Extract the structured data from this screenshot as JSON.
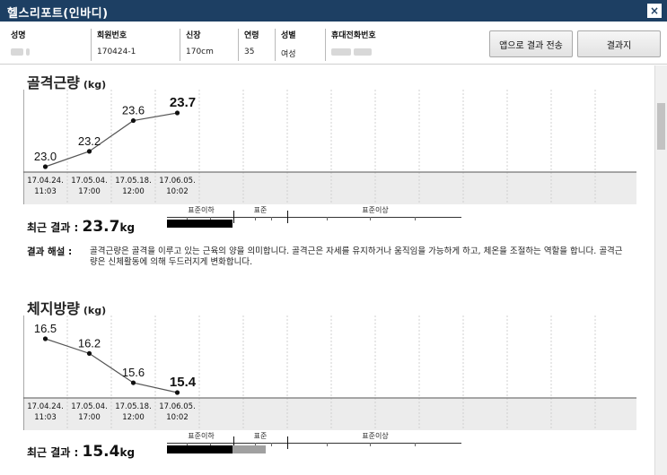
{
  "window": {
    "title": "헬스리포트(인바디)",
    "close_label": "×"
  },
  "member": {
    "name_label": "성명",
    "id_label": "회원번호",
    "id_value": "170424-1",
    "height_label": "신장",
    "height_value": "170cm",
    "age_label": "연령",
    "age_value": "35",
    "gender_label": "성별",
    "gender_value": "여성",
    "phone_label": "휴대전화번호"
  },
  "buttons": {
    "send_app": "앱으로 결과 전송",
    "result_sheet": "결과지"
  },
  "dates": [
    {
      "d": "17.04.24.",
      "t": "11:03"
    },
    {
      "d": "17.05.04.",
      "t": "17:00"
    },
    {
      "d": "17.05.18.",
      "t": "12:00"
    },
    {
      "d": "17.06.05.",
      "t": "10:02"
    }
  ],
  "gauge_labels": {
    "below": "표준이하",
    "standard": "표준",
    "above": "표준이상"
  },
  "muscle": {
    "title": "골격근량",
    "unit": "(kg)",
    "values": [
      23.0,
      23.2,
      23.6,
      23.7
    ],
    "value_labels": [
      "23.0",
      "23.2",
      "23.6",
      "23.7"
    ],
    "recent_label": "최근 결과 :",
    "recent_value": "23.7",
    "recent_unit": "kg",
    "interp_label": "결과 해설 :",
    "interp_text": "골격근량은 골격을 이루고 있는 근육의 양을 의미합니다. 골격근은 자세를 유지하거나 움직임을 가능하게 하고, 체온을 조절하는 역할을 합니다. 골격근량은 신체활동에 의해 두드러지게 변화합니다."
  },
  "fat": {
    "title": "체지방량",
    "unit": "(kg)",
    "values": [
      16.5,
      16.2,
      15.6,
      15.4
    ],
    "value_labels": [
      "16.5",
      "16.2",
      "15.6",
      "15.4"
    ],
    "recent_label": "최근 결과 :",
    "recent_value": "15.4",
    "recent_unit": "kg"
  },
  "colors": {
    "titlebar": "#1d3f63",
    "bar_dark": "#000000",
    "bar_light": "#a0a0a0",
    "date_band": "#ececec"
  }
}
